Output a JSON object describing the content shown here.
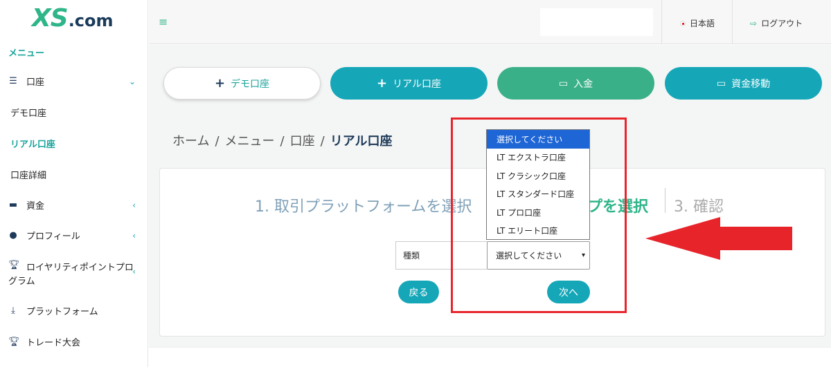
{
  "logo": {
    "xs": "XS",
    "com": ".com"
  },
  "sidebar": {
    "menu_header": "メニュー",
    "account": "口座",
    "demo_account": "デモ口座",
    "real_account": "リアル口座",
    "account_details": "口座詳細",
    "funds": "資金",
    "profile": "プロフィール",
    "loyalty_line1": "ロイヤリティポイントプロ",
    "loyalty_line2": "グラム",
    "platform": "プラットフォーム",
    "trade_contest": "トレード大会"
  },
  "header": {
    "language": "日本語",
    "logout": "ログアウト"
  },
  "actions": {
    "demo": "デモ口座",
    "real": "リアル口座",
    "deposit": "入金",
    "transfer": "資金移動"
  },
  "breadcrumb": {
    "home": "ホーム",
    "menu": "メニュー",
    "account": "口座",
    "current": "リアル口座"
  },
  "steps": {
    "step1": "1. 取引プラットフォームを選択",
    "step2": "プを選択",
    "step3": "3. 確認"
  },
  "form": {
    "type_label": "種類",
    "select_value": "選択してください",
    "back": "戻る",
    "next": "次へ"
  },
  "dropdown": {
    "options": [
      "選択してください",
      "LT エクストラ口座",
      "LT クラシック口座",
      "LT スタンダード口座",
      "LT プロ口座",
      "LT エリート口座"
    ],
    "selected_index": 0
  },
  "colors": {
    "teal": "#15a7b8",
    "green": "#3ab089",
    "highlight_red": "#e8242b",
    "select_blue": "#1e66d6"
  }
}
